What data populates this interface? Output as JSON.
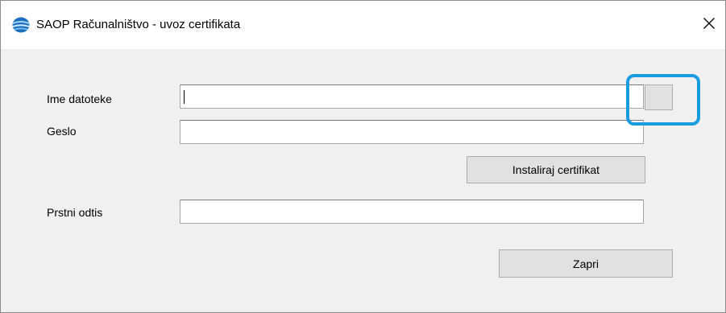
{
  "window": {
    "title": "SAOP Računalništvo - uvoz certifikata",
    "close_symbol": "✕"
  },
  "form": {
    "filename_label": "Ime datoteke",
    "filename_value": "",
    "browse_label": "",
    "password_label": "Geslo",
    "password_value": "",
    "install_button": "Instaliraj certifikat",
    "thumbprint_label": "Prstni odtis",
    "thumbprint_value": "",
    "close_button": "Zapri"
  },
  "icons": {
    "app": "saop-logo-icon",
    "close": "close-icon"
  },
  "colors": {
    "highlight": "#1a9be0",
    "titlebar": "#ffffff",
    "client": "#f0f0f0",
    "button_face": "#e1e1e1"
  }
}
